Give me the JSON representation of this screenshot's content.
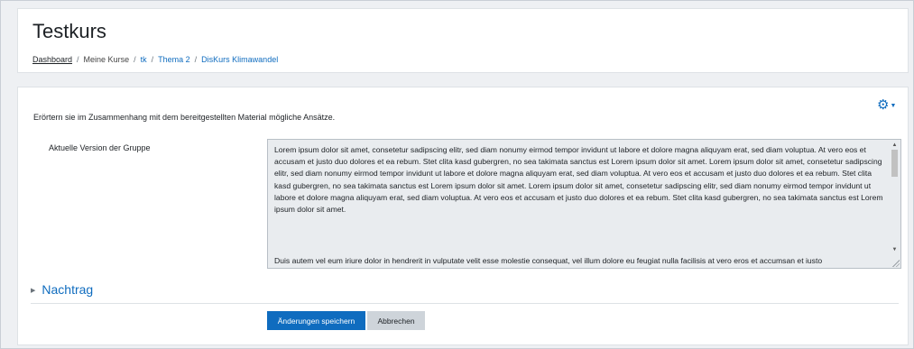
{
  "header": {
    "title": "Testkurs",
    "breadcrumb": [
      {
        "label": "Dashboard"
      },
      {
        "label": "Meine Kurse"
      },
      {
        "label": "tk"
      },
      {
        "label": "Thema 2"
      },
      {
        "label": "DisKurs Klimawandel"
      }
    ],
    "separator": "/"
  },
  "main": {
    "settings_icon": "gear-icon",
    "intro_text": "Erörtern sie im Zusammenhang mit dem bereitgestellten Material mögliche Ansätze.",
    "field_label": "Aktuelle Version der Gruppe",
    "editor_paragraph_1": "Lorem ipsum dolor sit amet, consetetur sadipscing elitr, sed diam nonumy eirmod tempor invidunt ut labore et dolore magna aliquyam erat, sed diam voluptua. At vero eos et accusam et justo duo dolores et ea rebum. Stet clita kasd gubergren, no sea takimata sanctus est Lorem ipsum dolor sit amet. Lorem ipsum dolor sit amet, consetetur sadipscing elitr, sed diam nonumy eirmod tempor invidunt ut labore et dolore magna aliquyam erat, sed diam voluptua. At vero eos et accusam et justo duo dolores et ea rebum. Stet clita kasd gubergren, no sea takimata sanctus est Lorem ipsum dolor sit amet. Lorem ipsum dolor sit amet, consetetur sadipscing elitr, sed diam nonumy eirmod tempor invidunt ut labore et dolore magna aliquyam erat, sed diam voluptua. At vero eos et accusam et justo duo dolores et ea rebum. Stet clita kasd gubergren, no sea takimata sanctus est Lorem ipsum dolor sit amet.",
    "editor_paragraph_2": "Duis autem vel eum iriure dolor in hendrerit in vulputate velit esse molestie consequat, vel illum dolore eu feugiat nulla facilisis at vero eros et accumsan et iusto",
    "section_title": "Nachtrag",
    "save_label": "Änderungen speichern",
    "cancel_label": "Abbrechen"
  },
  "colors": {
    "accent": "#0f6cbf",
    "secondary_button": "#ced4da",
    "editor_bg": "#e9ecef"
  }
}
